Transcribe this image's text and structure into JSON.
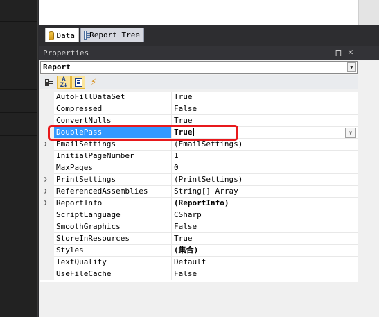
{
  "tabs": [
    {
      "label": "Data",
      "icon": "database-icon",
      "active": true
    },
    {
      "label": "Report Tree",
      "icon": "report-tree-icon",
      "active": false
    }
  ],
  "panel": {
    "title": "Properties",
    "pin_icon": "pin-icon",
    "close_icon": "close-icon"
  },
  "object_selector": {
    "value": "Report"
  },
  "toolbar": {
    "buttons": [
      {
        "name": "categorized-icon",
        "active": false
      },
      {
        "name": "alphabetical-sort-icon",
        "active": true
      },
      {
        "name": "property-pages-icon",
        "active": true
      },
      {
        "name": "events-lightning-icon",
        "active": false
      }
    ]
  },
  "properties": [
    {
      "name": "AutoFillDataSet",
      "value": "True"
    },
    {
      "name": "Compressed",
      "value": "False"
    },
    {
      "name": "ConvertNulls",
      "value": "True"
    },
    {
      "name": "DoublePass",
      "value": "True",
      "selected": true
    },
    {
      "name": "EmailSettings",
      "value": "(EmailSettings)",
      "expandable": true
    },
    {
      "name": "InitialPageNumber",
      "value": "1"
    },
    {
      "name": "MaxPages",
      "value": "0"
    },
    {
      "name": "PrintSettings",
      "value": "(PrintSettings)",
      "expandable": true
    },
    {
      "name": "ReferencedAssemblies",
      "value": "String[] Array",
      "expandable": true
    },
    {
      "name": "ReportInfo",
      "value": "(ReportInfo)",
      "expandable": true,
      "bold": true
    },
    {
      "name": "ScriptLanguage",
      "value": "CSharp"
    },
    {
      "name": "SmoothGraphics",
      "value": "False"
    },
    {
      "name": "StoreInResources",
      "value": "True"
    },
    {
      "name": "Styles",
      "value": "(集合)",
      "bold": true
    },
    {
      "name": "TextQuality",
      "value": "Default"
    },
    {
      "name": "UseFileCache",
      "value": "False"
    }
  ],
  "colors": {
    "selection": "#3399ff",
    "highlight_box": "#e8191c"
  }
}
